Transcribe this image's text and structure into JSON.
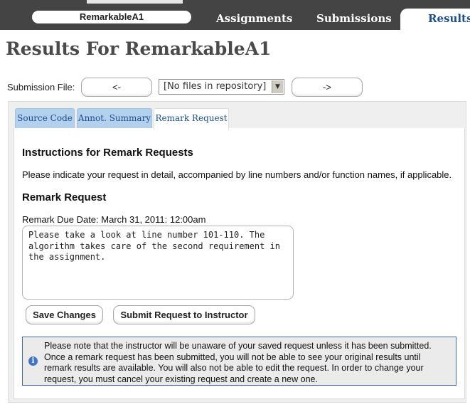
{
  "nav": {
    "assignment_name": "RemarkableA1",
    "tabs": [
      "Assignments",
      "Submissions",
      "Results"
    ],
    "active_tab": "Results"
  },
  "page_title": "Results For RemarkableA1",
  "submission": {
    "label": "Submission File:",
    "prev_label": "<-",
    "next_label": "->",
    "selected_file": "[No files in repository]"
  },
  "tabs": [
    {
      "label": "Source Code"
    },
    {
      "label": "Annot. Summary"
    },
    {
      "label": "Remark Request"
    }
  ],
  "remark": {
    "instructions_heading": "Instructions for Remark Requests",
    "instructions_text": "Please indicate your request in detail, accompanied by line numbers and/or function names, if applicable.",
    "heading": "Remark Request",
    "due_date": "Remark Due Date: March 31, 2011: 12:00am",
    "request_text": "Please take a look at line number 101-110.  The algorithm takes care of the second requirement in the assignment.",
    "save_label": "Save Changes",
    "submit_label": "Submit Request to Instructor",
    "notice": "Please note that the instructor will be unaware of your saved request unless it has been submitted. Once a remark request has been submitted, you will not be able to see your original results until remark results are available. You will also not be able to edit the request. In order to change your request, you must cancel your existing request and create a new one."
  },
  "colors": {
    "nav_bg": "#444444",
    "link_blue": "#1c4f8f",
    "tab_blue": "#b3d1ec",
    "notice_border": "#3a6aa8"
  },
  "icons": [
    "info-icon",
    "dropdown-arrow-icon"
  ]
}
